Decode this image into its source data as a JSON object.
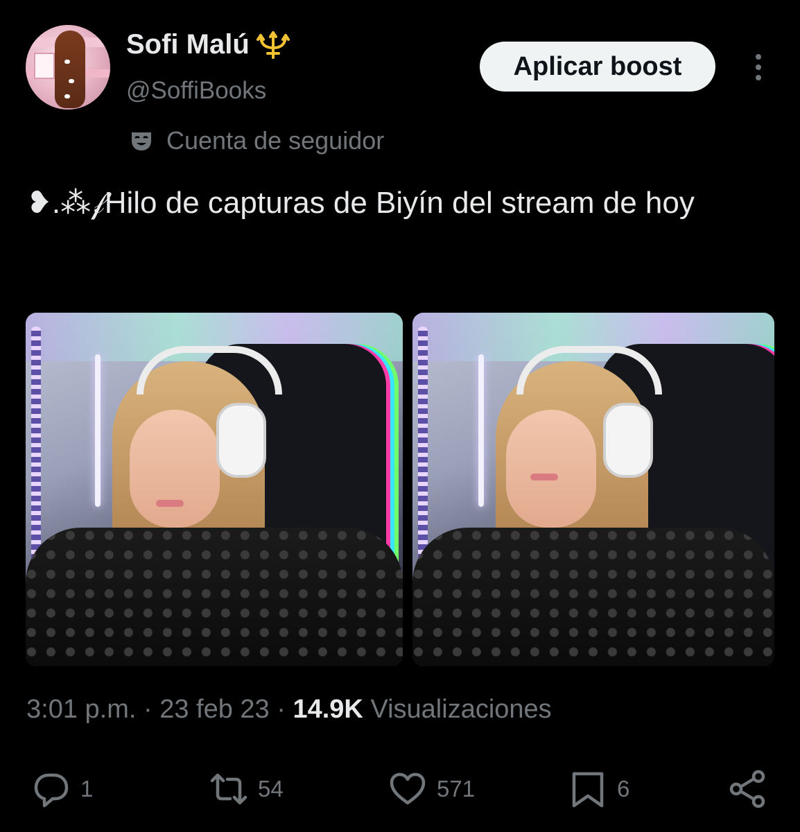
{
  "author": {
    "display_name": "Sofi Malú",
    "handle": "@SoffiBooks",
    "badge_icon": "trident-icon"
  },
  "boost_button_label": "Aplicar boost",
  "follower_label": "Cuenta de seguidor",
  "post": {
    "text": "❥.⁂𝒻Hilo de capturas de Biyín del stream de hoy"
  },
  "meta": {
    "time": "3:01 p.m.",
    "separator": "·",
    "date": "23 feb 23",
    "views_count": "14.9K",
    "views_label": "Visualizaciones"
  },
  "actions": {
    "replies": "1",
    "reposts": "54",
    "likes": "571",
    "bookmarks": "6"
  },
  "colors": {
    "background": "#000000",
    "text_primary": "#e7e9ea",
    "text_secondary": "#71767b",
    "button_bg": "#eff3f4",
    "trident": "#f2c233"
  }
}
